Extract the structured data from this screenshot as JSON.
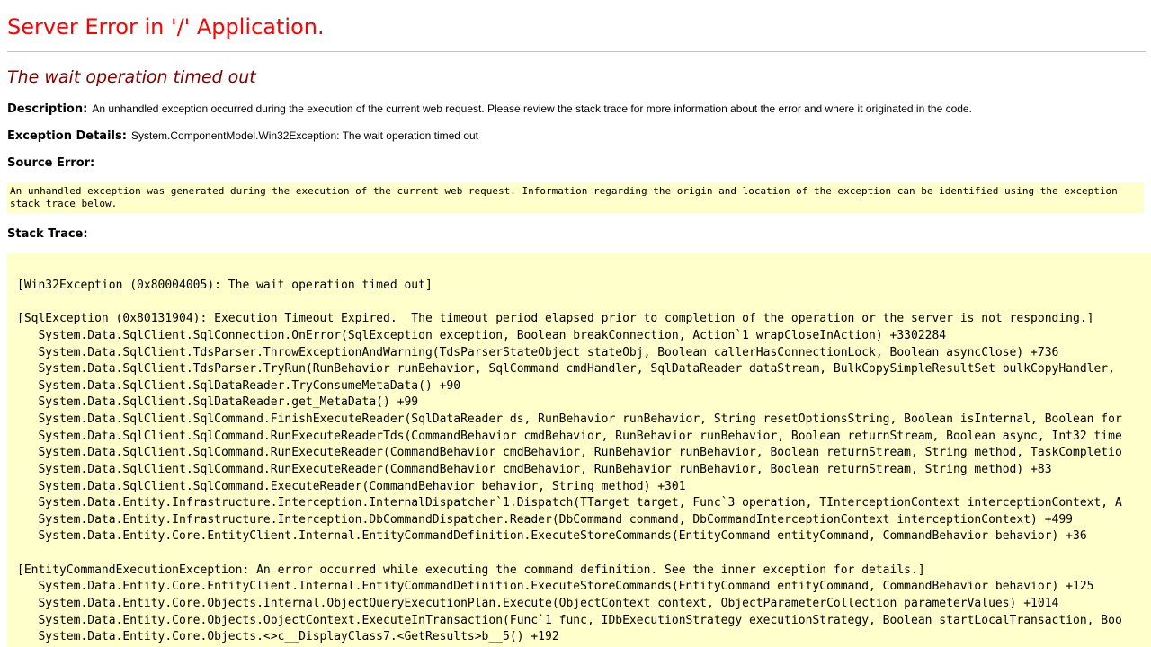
{
  "page": {
    "title": "Server Error in '/' Application.",
    "subtitle": "The wait operation timed out"
  },
  "description": {
    "label": "Description:",
    "text": "An unhandled exception occurred during the execution of the current web request. Please review the stack trace for more information about the error and where it originated in the code."
  },
  "exception_details": {
    "label": "Exception Details:",
    "text": "System.ComponentModel.Win32Exception: The wait operation timed out"
  },
  "source_error": {
    "label": "Source Error:",
    "text": "An unhandled exception was generated during the execution of the current web request. Information regarding the origin and location of the exception can be identified using the exception stack trace below."
  },
  "stack_trace": {
    "label": "Stack Trace:",
    "lines": [
      "[Win32Exception (0x80004005): The wait operation timed out]",
      "",
      "[SqlException (0x80131904): Execution Timeout Expired.  The timeout period elapsed prior to completion of the operation or the server is not responding.]",
      "   System.Data.SqlClient.SqlConnection.OnError(SqlException exception, Boolean breakConnection, Action`1 wrapCloseInAction) +3302284",
      "   System.Data.SqlClient.TdsParser.ThrowExceptionAndWarning(TdsParserStateObject stateObj, Boolean callerHasConnectionLock, Boolean asyncClose) +736",
      "   System.Data.SqlClient.TdsParser.TryRun(RunBehavior runBehavior, SqlCommand cmdHandler, SqlDataReader dataStream, BulkCopySimpleResultSet bulkCopyHandler,",
      "   System.Data.SqlClient.SqlDataReader.TryConsumeMetaData() +90",
      "   System.Data.SqlClient.SqlDataReader.get_MetaData() +99",
      "   System.Data.SqlClient.SqlCommand.FinishExecuteReader(SqlDataReader ds, RunBehavior runBehavior, String resetOptionsString, Boolean isInternal, Boolean for",
      "   System.Data.SqlClient.SqlCommand.RunExecuteReaderTds(CommandBehavior cmdBehavior, RunBehavior runBehavior, Boolean returnStream, Boolean async, Int32 time",
      "   System.Data.SqlClient.SqlCommand.RunExecuteReader(CommandBehavior cmdBehavior, RunBehavior runBehavior, Boolean returnStream, String method, TaskCompletio",
      "   System.Data.SqlClient.SqlCommand.RunExecuteReader(CommandBehavior cmdBehavior, RunBehavior runBehavior, Boolean returnStream, String method) +83",
      "   System.Data.SqlClient.SqlCommand.ExecuteReader(CommandBehavior behavior, String method) +301",
      "   System.Data.Entity.Infrastructure.Interception.InternalDispatcher`1.Dispatch(TTarget target, Func`3 operation, TInterceptionContext interceptionContext, A",
      "   System.Data.Entity.Infrastructure.Interception.DbCommandDispatcher.Reader(DbCommand command, DbCommandInterceptionContext interceptionContext) +499",
      "   System.Data.Entity.Core.EntityClient.Internal.EntityCommandDefinition.ExecuteStoreCommands(EntityCommand entityCommand, CommandBehavior behavior) +36",
      "",
      "[EntityCommandExecutionException: An error occurred while executing the command definition. See the inner exception for details.]",
      "   System.Data.Entity.Core.EntityClient.Internal.EntityCommandDefinition.ExecuteStoreCommands(EntityCommand entityCommand, CommandBehavior behavior) +125",
      "   System.Data.Entity.Core.Objects.Internal.ObjectQueryExecutionPlan.Execute(ObjectContext context, ObjectParameterCollection parameterValues) +1014",
      "   System.Data.Entity.Core.Objects.ObjectContext.ExecuteInTransaction(Func`1 func, IDbExecutionStrategy executionStrategy, Boolean startLocalTransaction, Boo",
      "   System.Data.Entity.Core.Objects.<>c__DisplayClass7.<GetResults>b__5() +192"
    ]
  }
}
